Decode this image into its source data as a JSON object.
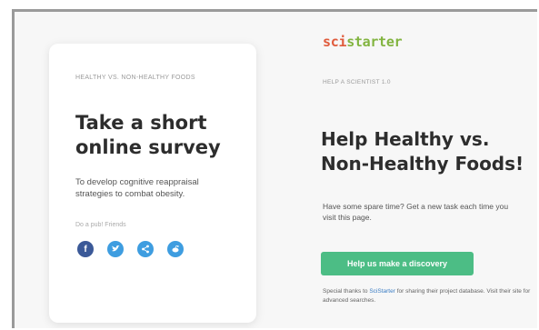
{
  "card": {
    "eyebrow": "HEALTHY VS. NON-HEALTHY FOODS",
    "title": "Take a short online survey",
    "description": "To develop cognitive reappraisal strategies to combat obesity.",
    "share_label": "Do a pub! Friends",
    "share_buttons": [
      {
        "icon": "facebook-icon",
        "color": "#3b5998",
        "glyph": "f"
      },
      {
        "icon": "twitter-icon",
        "color": "#3e9de0",
        "glyph": "t"
      },
      {
        "icon": "share-icon",
        "color": "#3e9de0",
        "glyph": "<"
      },
      {
        "icon": "reddit-icon",
        "color": "#3e9de0",
        "glyph": "r"
      }
    ]
  },
  "main": {
    "logo_part1": "sci",
    "logo_part2": "starter",
    "eyebrow": "HELP A SCIENTIST 1.0",
    "headline": "Help Healthy vs. Non-Healthy Foods!",
    "subtext": "Have some spare time? Get a new task each time you visit this page.",
    "cta_label": "Help us make a discovery",
    "thanks_prefix": "Special thanks to",
    "thanks_link": "SciStarter",
    "thanks_suffix": "for sharing their project database. Visit their site for advanced searches."
  },
  "colors": {
    "cta": "#4cbd85",
    "logo_orange": "#e05b3c",
    "logo_green": "#82b440",
    "facebook": "#3b5998",
    "twitter": "#3e9de0"
  }
}
